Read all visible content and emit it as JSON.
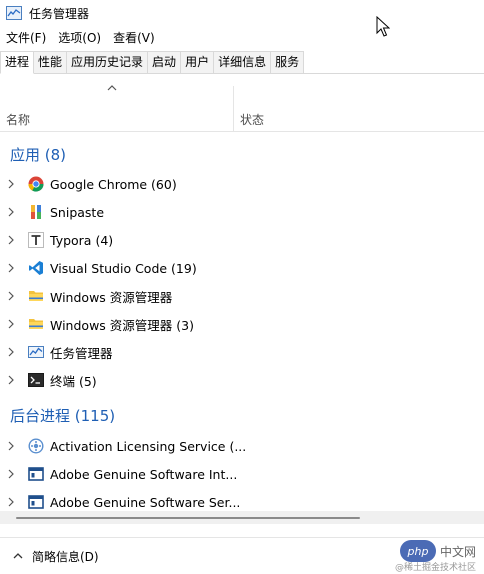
{
  "window": {
    "title": "任务管理器",
    "icon": "task-manager-icon"
  },
  "menu": [
    "文件(F)",
    "选项(O)",
    "查看(V)"
  ],
  "tabs": [
    "进程",
    "性能",
    "应用历史记录",
    "启动",
    "用户",
    "详细信息",
    "服务"
  ],
  "active_tab": "进程",
  "columns": {
    "name": "名称",
    "status": "状态"
  },
  "sections": {
    "apps": {
      "title": "应用 (8)",
      "items": [
        {
          "label": "Google Chrome (60)",
          "icon": "chrome-icon"
        },
        {
          "label": "Snipaste",
          "icon": "snipaste-icon"
        },
        {
          "label": "Typora (4)",
          "icon": "typora-icon"
        },
        {
          "label": "Visual Studio Code (19)",
          "icon": "vscode-icon"
        },
        {
          "label": "Windows 资源管理器",
          "icon": "folder-icon"
        },
        {
          "label": "Windows 资源管理器 (3)",
          "icon": "folder-icon"
        },
        {
          "label": "任务管理器",
          "icon": "task-manager-icon"
        },
        {
          "label": "终端 (5)",
          "icon": "terminal-icon"
        }
      ]
    },
    "background": {
      "title": "后台进程 (115)",
      "items": [
        {
          "label": "Activation Licensing Service (...",
          "icon": "gear-service-icon"
        },
        {
          "label": "Adobe Genuine Software Int...",
          "icon": "app-window-icon"
        },
        {
          "label": "Adobe Genuine Software Ser...",
          "icon": "app-window-icon"
        }
      ]
    }
  },
  "footer": {
    "fewer_details": "简略信息(D)"
  },
  "watermark": {
    "logo": "php",
    "site": "中文网",
    "sub": "@稀土掘金技术社区"
  },
  "colors": {
    "section_title": "#1f5fb4",
    "tab_border": "#d9d9d9"
  }
}
